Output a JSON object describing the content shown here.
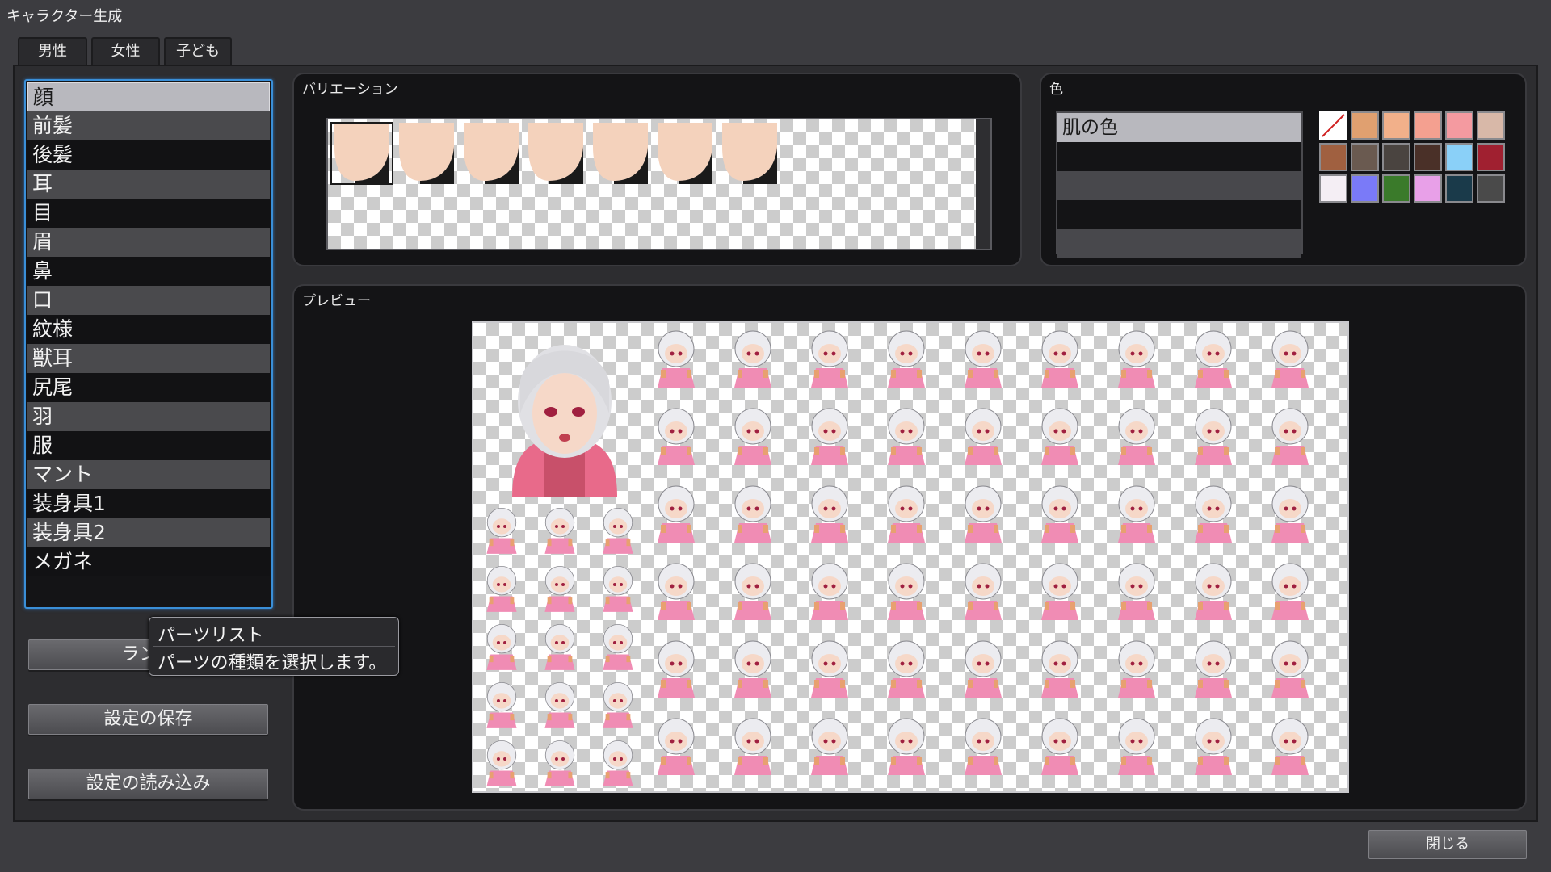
{
  "window": {
    "title": "キャラクター生成"
  },
  "tabs": [
    {
      "label": "男性"
    },
    {
      "label": "女性"
    },
    {
      "label": "子ども"
    }
  ],
  "parts": {
    "items": [
      "顔",
      "前髪",
      "後髪",
      "耳",
      "目",
      "眉",
      "鼻",
      "口",
      "紋様",
      "獣耳",
      "尻尾",
      "羽",
      "服",
      "マント",
      "装身具1",
      "装身具2",
      "メガネ"
    ],
    "selected_index": 0
  },
  "buttons": {
    "random": "ランダ",
    "save": "設定の保存",
    "load": "設定の読み込み",
    "close": "閉じる"
  },
  "tooltip": {
    "title": "パーツリスト",
    "description": "パーツの種類を選択します。"
  },
  "variation": {
    "title": "バリエーション",
    "count": 7,
    "selected_index": 0
  },
  "color": {
    "title": "色",
    "items": [
      "肌の色"
    ],
    "selected_index": 0,
    "swatches": [
      "none",
      "#e0a070",
      "#f2b08a",
      "#f4a090",
      "#f49aa0",
      "#d8b8a8",
      "#a06040",
      "#6a5a50",
      "#4a4440",
      "#4a3028",
      "#8ad0f8",
      "#a02030",
      "#f4eef4",
      "#7a7af8",
      "#3a7a2a",
      "#e8a0e8",
      "#1a3a4a",
      "#4a4a4a"
    ],
    "accent": "#3a8fd8"
  },
  "preview": {
    "title": "プレビュー"
  }
}
